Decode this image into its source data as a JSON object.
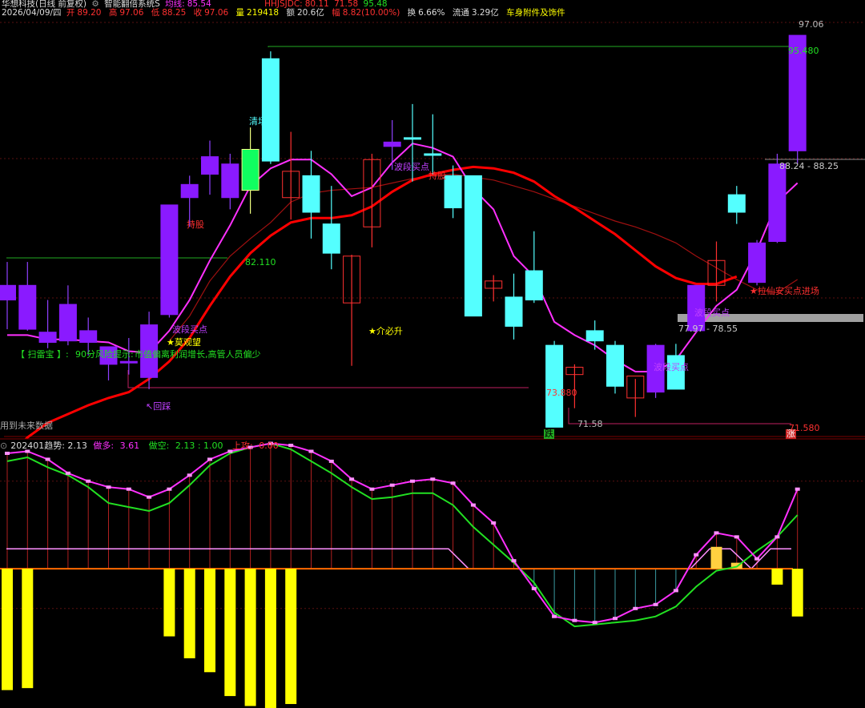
{
  "header": {
    "title": "华想科技(日线 前复权)",
    "system_name": "智能翻倍系统S",
    "ma_label": "均线:",
    "ma_value": "85.54",
    "hhjsjdc_label": "HHJSJDC:",
    "hhjsjdc_value": "80.11",
    "val2": "71.58",
    "val3": "95.48",
    "date": "2026/04/09/四",
    "open_label": "开",
    "open": "89.20",
    "high_label": "高",
    "high": "97.06",
    "low_label": "低",
    "low": "88.25",
    "close_label": "收",
    "close": "97.06",
    "volume_label": "量",
    "volume": "219418",
    "amount_label": "额",
    "amount": "20.6亿",
    "change_label": "幅",
    "change": "8.82(10.00%)",
    "turnover_label": "换",
    "turnover": "6.66%",
    "float_label": "流通",
    "float": "3.29亿",
    "sector": "车身附件及饰件"
  },
  "annotations": {
    "hold1": "持股",
    "hold2": "持股",
    "buy1": "波段买点",
    "buy2": "波段买点",
    "buy3": "波段买点",
    "buy4": "波段买点",
    "moguan": "★莫观望",
    "must_rise": "★介必升",
    "exit": "清场 出",
    "huicai": "↖回踩",
    "entry": "进场",
    "entry_signal": "★拉仙安买点进场",
    "saoleibao": "【 扫雷宝 】:",
    "risk": "90分风险提示:",
    "risk_text": "市值偏离利润增长,高管人员偏少",
    "future_data": "用到未来数据",
    "die": "跌",
    "zhang": "涨"
  },
  "price_labels": {
    "p82110": "82.110",
    "p73880": "73.880",
    "p7158": "71.58",
    "p71580": "71.580",
    "p95480": "95.480",
    "p9706": "97.06",
    "zone_upper": "88.24 - 88.25",
    "zone_lower": "77.97 - 78.55"
  },
  "indicator": {
    "name": "202401趋势",
    "name_value": ": 2.13",
    "zuoduo_label": "做多:",
    "zuoduo_value": "3.61",
    "zuokong_label": "做空:",
    "zuokong_value": "2.13 : 1.00",
    "shanggong_label": "上攻:",
    "shanggong_value": "0.00"
  },
  "colors": {
    "up": "#ff3030",
    "up_body": "#000000",
    "down": "#54ffff",
    "purple_up": "#8a1aff",
    "magenta": "#ff30ff",
    "red_ma": "#ff0000",
    "dark_red_ma": "#a01010",
    "green": "#22e022",
    "yellow": "#ffff00",
    "gray_band": "#a0a0a0"
  },
  "chart_data": {
    "type": "candlestick",
    "price_range": [
      69.5,
      98.2
    ],
    "candles": [
      {
        "o": 79.0,
        "h": 81.6,
        "l": 77.0,
        "c": 80.0,
        "k": "p"
      },
      {
        "o": 80.0,
        "h": 81.6,
        "l": 76.9,
        "c": 77.0,
        "k": "p"
      },
      {
        "o": 76.8,
        "h": 79.0,
        "l": 75.7,
        "c": 76.1,
        "k": "p"
      },
      {
        "o": 76.2,
        "h": 80.0,
        "l": 75.9,
        "c": 78.7,
        "k": "p"
      },
      {
        "o": 76.9,
        "h": 77.8,
        "l": 75.2,
        "c": 76.1,
        "k": "p"
      },
      {
        "o": 74.6,
        "h": 75.6,
        "l": 73.5,
        "c": 75.8,
        "k": "p"
      },
      {
        "o": 74.8,
        "h": 76.4,
        "l": 73.9,
        "c": 74.8,
        "k": "p"
      },
      {
        "o": 73.7,
        "h": 78.2,
        "l": 72.9,
        "c": 77.3,
        "k": "p"
      },
      {
        "o": 78.0,
        "h": 84.8,
        "l": 77.8,
        "c": 85.5,
        "k": "p"
      },
      {
        "o": 86.0,
        "h": 87.5,
        "l": 84.0,
        "c": 86.9,
        "k": "p"
      },
      {
        "o": 87.6,
        "h": 89.9,
        "l": 86.2,
        "c": 88.8,
        "k": "p"
      },
      {
        "o": 86.0,
        "h": 89.0,
        "l": 85.2,
        "c": 88.3,
        "k": "p"
      },
      {
        "o": 86.5,
        "h": 90.8,
        "l": 84.9,
        "c": 89.3,
        "k": "g"
      },
      {
        "o": 88.5,
        "h": 96.0,
        "l": 88.3,
        "c": 95.5,
        "k": "c"
      },
      {
        "o": 86.0,
        "h": 90.5,
        "l": 84.5,
        "c": 87.8,
        "k": "r"
      },
      {
        "o": 87.5,
        "h": 89.2,
        "l": 83.2,
        "c": 85.0,
        "k": "c"
      },
      {
        "o": 84.2,
        "h": 86.8,
        "l": 81.1,
        "c": 82.2,
        "k": "c"
      },
      {
        "o": 78.8,
        "h": 82.1,
        "l": 74.5,
        "c": 82.0,
        "k": "r"
      },
      {
        "o": 84.0,
        "h": 89.0,
        "l": 82.6,
        "c": 88.6,
        "k": "r"
      },
      {
        "o": 89.5,
        "h": 91.3,
        "l": 87.9,
        "c": 89.8,
        "k": "p"
      },
      {
        "o": 90.1,
        "h": 92.4,
        "l": 87.1,
        "c": 90.1,
        "k": "c"
      },
      {
        "o": 89.0,
        "h": 91.7,
        "l": 87.6,
        "c": 89.0,
        "k": "c"
      },
      {
        "o": 87.5,
        "h": 88.2,
        "l": 84.6,
        "c": 85.3,
        "k": "c"
      },
      {
        "o": 87.5,
        "h": 87.5,
        "l": 77.9,
        "c": 77.9,
        "k": "c"
      },
      {
        "o": 80.3,
        "h": 80.7,
        "l": 78.9,
        "c": 79.8,
        "k": "r"
      },
      {
        "o": 79.2,
        "h": 80.8,
        "l": 76.3,
        "c": 77.2,
        "k": "c"
      },
      {
        "o": 81.0,
        "h": 83.7,
        "l": 78.8,
        "c": 79.0,
        "k": "c"
      },
      {
        "o": 75.9,
        "h": 76.2,
        "l": 70.3,
        "c": 70.3,
        "k": "c"
      },
      {
        "o": 74.4,
        "h": 74.6,
        "l": 71.6,
        "c": 73.9,
        "k": "r"
      },
      {
        "o": 76.9,
        "h": 77.6,
        "l": 75.6,
        "c": 76.2,
        "k": "c"
      },
      {
        "o": 75.9,
        "h": 76.2,
        "l": 72.6,
        "c": 73.1,
        "k": "c"
      },
      {
        "o": 72.3,
        "h": 73.6,
        "l": 71.0,
        "c": 73.8,
        "k": "r"
      },
      {
        "o": 72.7,
        "h": 76.0,
        "l": 72.3,
        "c": 75.9,
        "k": "p"
      },
      {
        "o": 75.2,
        "h": 76.0,
        "l": 73.1,
        "c": 72.9,
        "k": "c"
      },
      {
        "o": 76.9,
        "h": 80.0,
        "l": 76.8,
        "c": 80.0,
        "k": "p"
      },
      {
        "o": 80.0,
        "h": 83.0,
        "l": 78.9,
        "c": 81.7,
        "k": "r"
      },
      {
        "o": 85.0,
        "h": 86.8,
        "l": 84.2,
        "c": 86.2,
        "k": "c"
      },
      {
        "o": 80.2,
        "h": 83.1,
        "l": 80.0,
        "c": 82.9,
        "k": "p"
      },
      {
        "o": 83.0,
        "h": 89.0,
        "l": 82.9,
        "c": 88.3,
        "k": "p"
      },
      {
        "o": 89.2,
        "h": 97.1,
        "l": 88.3,
        "c": 97.1,
        "k": "p"
      }
    ],
    "ma_magenta": [
      76.6,
      76.6,
      76.3,
      76.3,
      76.2,
      76.1,
      75.5,
      75.4,
      76.9,
      79.0,
      81.7,
      84.1,
      86.8,
      88.0,
      88.6,
      88.6,
      87.6,
      86.1,
      86.7,
      88.4,
      89.7,
      89.4,
      88.8,
      86.6,
      85.2,
      82.0,
      80.6,
      77.5,
      76.6,
      75.9,
      74.9,
      74.1,
      74.1,
      74.9,
      76.8,
      78.6,
      79.7,
      82.4,
      85.7,
      87.0
    ],
    "ma_red": [
      68.2,
      69.6,
      70.6,
      71.2,
      71.8,
      72.3,
      72.7,
      73.6,
      74.8,
      76.4,
      78.6,
      80.6,
      82.2,
      83.4,
      84.3,
      84.6,
      84.6,
      84.8,
      85.4,
      86.4,
      87.2,
      87.6,
      87.9,
      88.1,
      88.0,
      87.7,
      87.1,
      86.1,
      85.3,
      84.4,
      83.5,
      82.4,
      81.3,
      80.5,
      80.1,
      80.1,
      80.6
    ],
    "ma_darkred_start_index": 8,
    "ma_darkred": [
      76.2,
      77.9,
      80.3,
      82.0,
      83.2,
      84.3,
      85.7,
      86.3,
      86.5,
      86.6,
      86.7,
      87.0,
      87.3,
      87.5,
      87.6,
      87.4,
      87.2,
      86.8,
      86.4,
      85.9,
      85.4,
      84.9,
      84.4,
      84.0,
      83.5,
      82.9,
      82.0,
      81.2,
      80.4,
      79.7,
      79.5,
      80.4
    ],
    "indicator_range": [
      -7.0,
      5.8
    ],
    "ind_bars_neg": [
      [
        0,
        -6.1
      ],
      [
        1,
        -6.0
      ],
      [
        8,
        -3.4
      ],
      [
        9,
        -4.5
      ],
      [
        10,
        -5.2
      ],
      [
        11,
        -6.4
      ],
      [
        12,
        -6.9
      ],
      [
        13,
        -7.2
      ],
      [
        14,
        -6.8
      ],
      [
        38,
        -0.8
      ],
      [
        39,
        -2.4
      ]
    ],
    "ind_bars_pos": [
      [
        35,
        1.1
      ],
      [
        36,
        0.3
      ]
    ],
    "ind_magenta": [
      5.8,
      5.9,
      5.5,
      4.8,
      4.4,
      4.1,
      4.0,
      3.6,
      4.0,
      4.7,
      5.5,
      5.9,
      6.1,
      6.3,
      6.2,
      5.9,
      5.4,
      4.5,
      4.0,
      4.2,
      4.4,
      4.5,
      4.3,
      3.2,
      2.3,
      0.4,
      -1.0,
      -2.4,
      -2.6,
      -2.7,
      -2.5,
      -2.0,
      -1.8,
      -1.1,
      0.7,
      1.8,
      1.6,
      0.5,
      1.6,
      4.0
    ],
    "ind_green": [
      5.4,
      5.6,
      5.1,
      4.7,
      4.1,
      3.3,
      3.1,
      2.9,
      3.3,
      4.2,
      5.2,
      5.8,
      6.1,
      6.3,
      6.0,
      5.4,
      4.8,
      4.1,
      3.5,
      3.6,
      3.8,
      3.8,
      3.2,
      2.1,
      1.2,
      0.3,
      -0.7,
      -2.2,
      -2.9,
      -2.8,
      -2.7,
      -2.6,
      -2.4,
      -1.9,
      -0.9,
      -0.1,
      0.1,
      0.9,
      1.6,
      2.7
    ],
    "ind_pink_flat": 1.0
  }
}
